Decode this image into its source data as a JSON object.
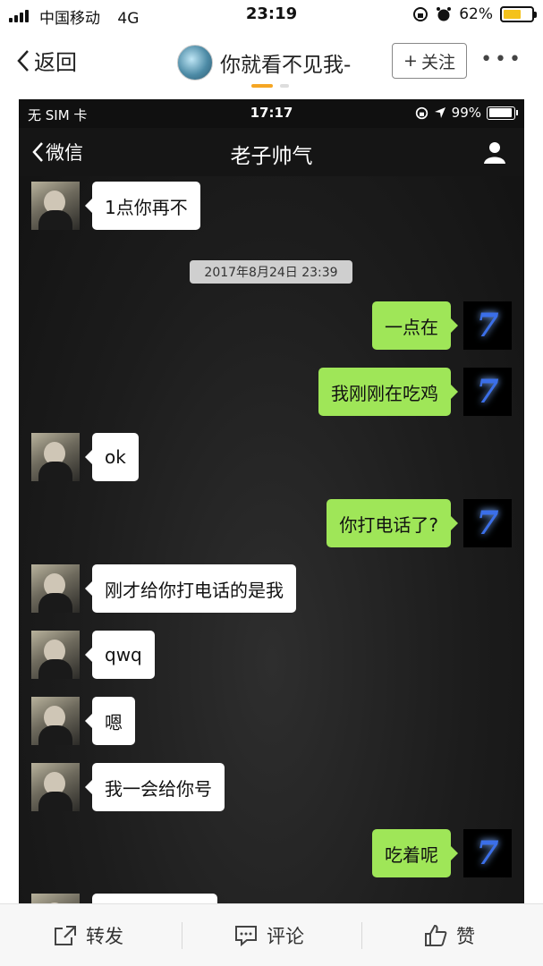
{
  "outer_status": {
    "carrier": "中国移动",
    "network": "4G",
    "time": "23:19",
    "battery": "62%",
    "battery_color": "#f4c21b"
  },
  "nav": {
    "back_label": "返回",
    "title": "你就看不见我-",
    "follow_label": "关注",
    "more": "•••"
  },
  "phone": {
    "status": {
      "sim": "无 SIM 卡",
      "time": "17:17",
      "battery": "99%"
    },
    "header": {
      "back_label": "微信",
      "title": "老子帅气"
    },
    "timestamp": "2017年8月24日 23:39",
    "messages": [
      {
        "side": "left",
        "text": "1点你再不"
      },
      {
        "side": "right",
        "text": "一点在"
      },
      {
        "side": "right",
        "text": "我刚刚在吃鸡"
      },
      {
        "side": "left",
        "text": "ok"
      },
      {
        "side": "right",
        "text": "你打电话了?"
      },
      {
        "side": "left",
        "text": "刚才给你打电话的是我"
      },
      {
        "side": "left",
        "text": "qwq"
      },
      {
        "side": "left",
        "text": "嗯"
      },
      {
        "side": "left",
        "text": "我一会给你号"
      },
      {
        "side": "right",
        "text": "吃着呢"
      }
    ],
    "right_avatar_glyph": "7",
    "bubble_colors": {
      "sent": "#9fe658",
      "received": "#ffffff"
    }
  },
  "bottom": {
    "share": "转发",
    "comment": "评论",
    "like": "赞"
  }
}
